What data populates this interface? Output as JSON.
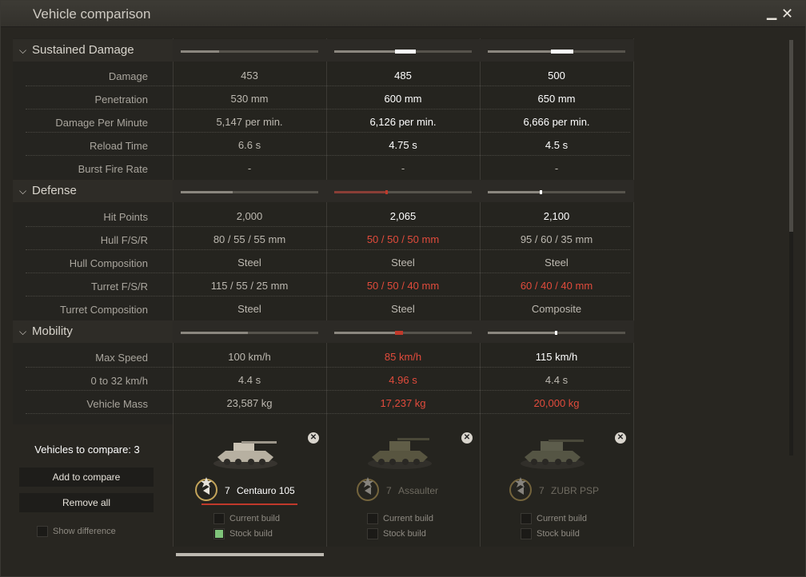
{
  "window": {
    "title": "Vehicle comparison",
    "minimize": "▁",
    "close": "✕"
  },
  "sections": {
    "sustained": {
      "title": "Sustained Damage"
    },
    "defense": {
      "title": "Defense"
    },
    "mobility": {
      "title": "Mobility"
    }
  },
  "rows": {
    "damage": {
      "label": "Damage",
      "values": [
        "453",
        "485",
        "500"
      ]
    },
    "penetration": {
      "label": "Penetration",
      "values": [
        "530 mm",
        "600 mm",
        "650 mm"
      ]
    },
    "dpm": {
      "label": "Damage Per Minute",
      "values": [
        "5,147 per min.",
        "6,126 per min.",
        "6,666 per min."
      ]
    },
    "reload": {
      "label": "Reload Time",
      "values": [
        "6.6 s",
        "4.75 s",
        "4.5 s"
      ]
    },
    "burst": {
      "label": "Burst Fire Rate",
      "values": [
        "-",
        "-",
        "-"
      ]
    },
    "hp": {
      "label": "Hit Points",
      "values": [
        "2,000",
        "2,065",
        "2,100"
      ]
    },
    "hull": {
      "label": "Hull F/S/R",
      "values": [
        "80 / 55 / 55 mm",
        "50 / 50 / 50 mm",
        "95 / 60 / 35 mm"
      ]
    },
    "hullcomp": {
      "label": "Hull Composition",
      "values": [
        "Steel",
        "Steel",
        "Steel"
      ]
    },
    "turret": {
      "label": "Turret F/S/R",
      "values": [
        "115 / 55 / 25 mm",
        "50 / 50 / 40 mm",
        "60 / 40 / 40 mm"
      ]
    },
    "turretcomp": {
      "label": "Turret Composition",
      "values": [
        "Steel",
        "Steel",
        "Composite"
      ]
    },
    "speed": {
      "label": "Max Speed",
      "values": [
        "100 km/h",
        "85 km/h",
        "115 km/h"
      ]
    },
    "accel": {
      "label": "0 to 32 km/h",
      "values": [
        "4.4 s",
        "4.96 s",
        "4.4 s"
      ]
    },
    "mass": {
      "label": "Vehicle Mass",
      "values": [
        "23,587 kg",
        "17,237 kg",
        "20,000 kg"
      ]
    }
  },
  "section_bars": {
    "sustained": [
      0.28,
      0.44,
      0.46
    ],
    "defense": [
      0.38,
      0.37,
      0.38
    ],
    "mobility": [
      0.49,
      0.44,
      0.49
    ]
  },
  "bottom": {
    "vehicles_to_compare": "Vehicles to compare: 3",
    "add_button": "Add to compare",
    "remove_button": "Remove all",
    "show_difference": "Show difference"
  },
  "vehicles": [
    {
      "tier": "7",
      "name": "Centauro 105",
      "current_build": "Current build",
      "stock_build": "Stock build"
    },
    {
      "tier": "7",
      "name": "Assaulter",
      "current_build": "Current build",
      "stock_build": "Stock build"
    },
    {
      "tier": "7",
      "name": "ZUBR PSP",
      "current_build": "Current build",
      "stock_build": "Stock build"
    }
  ],
  "icons": {
    "close": "close-icon",
    "chevron": "chevron-down-icon",
    "tier_badge": "tier-badge-icon"
  },
  "colors": {
    "red": "#e14b3c",
    "white": "#ffffff",
    "neutral": "#bdb9b1",
    "accent_red": "#c0392b",
    "check_green": "#7fc47a"
  }
}
